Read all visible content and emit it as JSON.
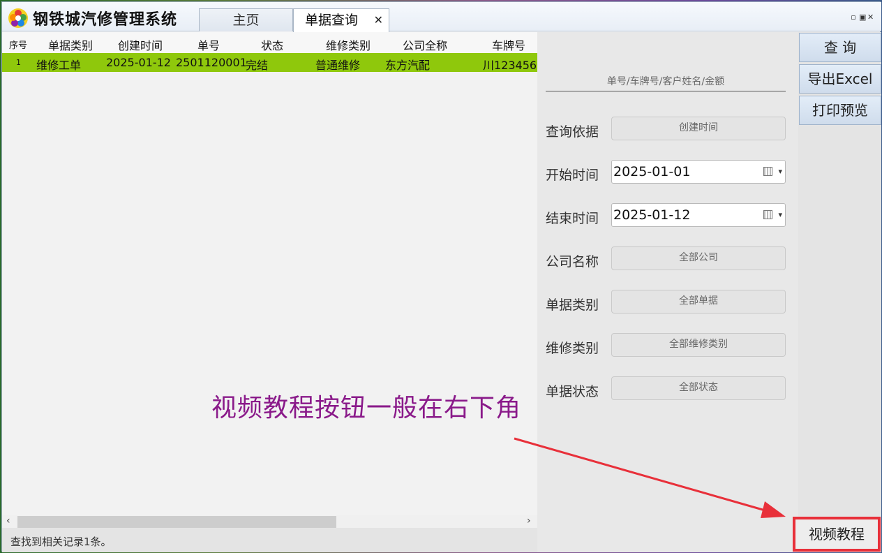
{
  "app": {
    "title": "钢铁城汽修管理系统"
  },
  "tabs": [
    {
      "label": "主页"
    },
    {
      "label": "单据查询",
      "close": "✕"
    }
  ],
  "window_controls": {
    "restore": "▫",
    "maximize": "▣",
    "close": "✕"
  },
  "grid": {
    "columns": [
      "序号",
      "单据类别",
      "创建时间",
      "单号",
      "状态",
      "维修类别",
      "公司全称",
      "车牌号"
    ],
    "rows": [
      [
        "1",
        "维修工单",
        "2025-01-12",
        "2501120001",
        "完结",
        "普通维修",
        "东方汽配",
        "川123456"
      ]
    ],
    "row_highlight_color": "#8fc80c",
    "scroll_left": "‹",
    "scroll_right": "›"
  },
  "status": {
    "text": "查找到相关记录1条。"
  },
  "query": {
    "keyword_placeholder": "单号/车牌号/客户姓名/金额",
    "fields": [
      {
        "label": "查询依据",
        "value": "创建时间"
      },
      {
        "label": "开始时间",
        "value": "2025-01-01"
      },
      {
        "label": "结束时间",
        "value": "2025-01-12"
      },
      {
        "label": "公司名称",
        "value": "全部公司"
      },
      {
        "label": "单据类别",
        "value": "全部单据"
      },
      {
        "label": "维修类别",
        "value": "全部维修类别"
      },
      {
        "label": "单据状态",
        "value": "全部状态"
      }
    ]
  },
  "buttons": {
    "query": "查 询",
    "export": "导出Excel",
    "print": "打印预览",
    "video": "视频教程"
  },
  "annotation": {
    "text": "视频教程按钮一般在右下角",
    "color": "#8a1a8a",
    "arrow_color": "#e8303a"
  }
}
